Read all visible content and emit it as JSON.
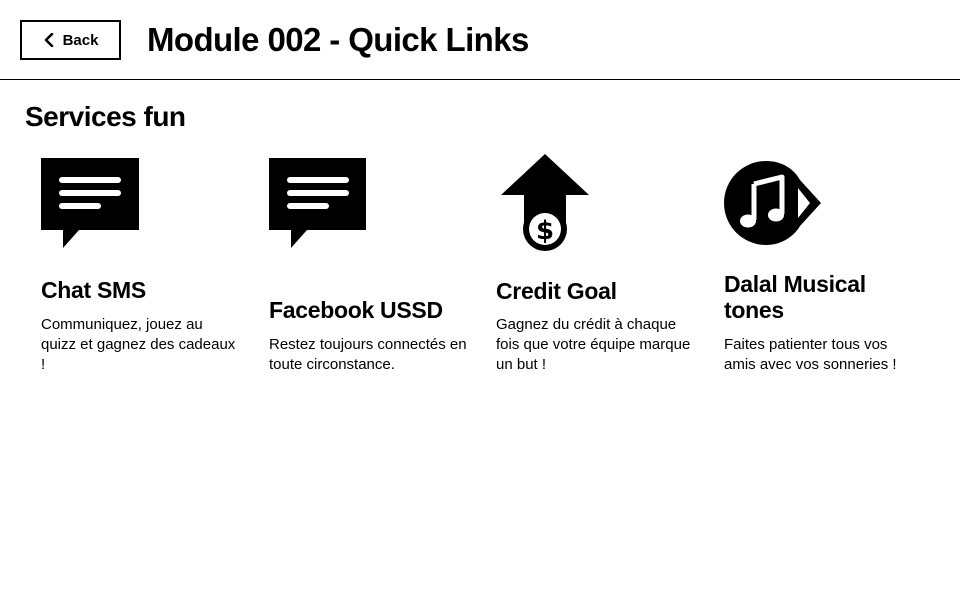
{
  "header": {
    "back_label": "Back",
    "title": "Module 002 - Quick Links"
  },
  "section": {
    "title": "Services fun"
  },
  "cards": [
    {
      "icon": "chat-bubble-icon",
      "title": "Chat SMS",
      "description": "Communiquez, jouez au quizz et gagnez des cadeaux !"
    },
    {
      "icon": "chat-bubble-icon",
      "title": "Facebook USSD",
      "description": "Restez toujours connectés en toute circonstance."
    },
    {
      "icon": "dollar-arrow-up-icon",
      "title": "Credit Goal",
      "description": "Gagnez du crédit à chaque fois que votre équipe marque un but !"
    },
    {
      "icon": "music-play-icon",
      "title": "Dalal Musical tones",
      "description": "Faites patienter tous vos amis avec vos sonneries !"
    }
  ],
  "colors": {
    "text": "#000000",
    "background": "#ffffff",
    "border": "#000000"
  }
}
